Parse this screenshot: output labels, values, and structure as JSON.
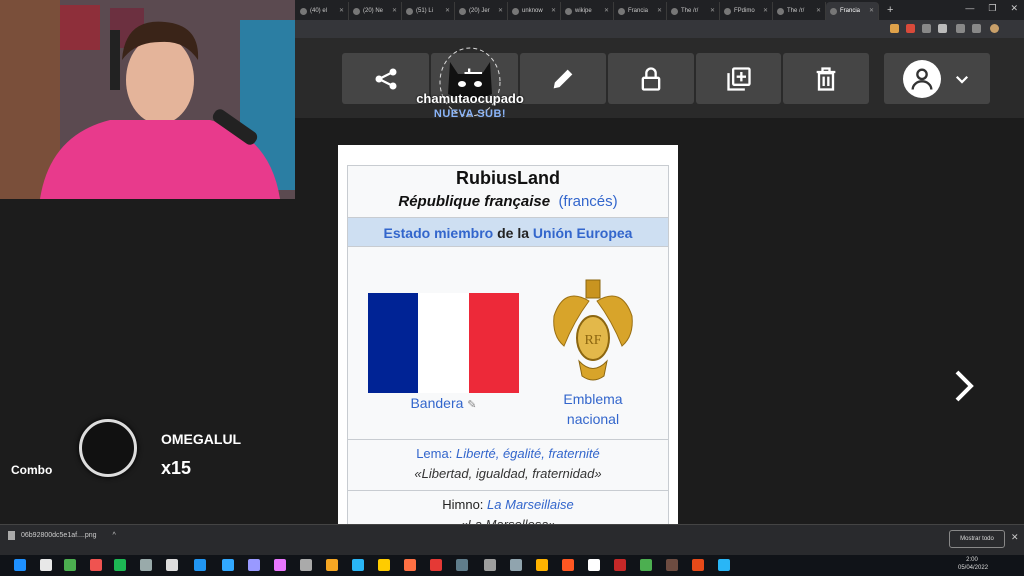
{
  "browser": {
    "tabs": [
      {
        "label": "(40) el"
      },
      {
        "label": "(20) Ne"
      },
      {
        "label": "(51) Li"
      },
      {
        "label": "(20) Jer"
      },
      {
        "label": "unknow"
      },
      {
        "label": "wikipe"
      },
      {
        "label": "Francia"
      },
      {
        "label": "The /r/"
      },
      {
        "label": "FPdimo"
      },
      {
        "label": "The /r/"
      },
      {
        "label": "Francia",
        "active": true
      }
    ],
    "new_tab": "+"
  },
  "viewer_toolbar": {
    "icons": [
      "share-icon",
      "crop-rotate-icon",
      "edit-pencil-icon",
      "lock-icon",
      "copy-add-icon",
      "trash-icon"
    ],
    "user_icon": "user-avatar-icon",
    "dropdown_icon": "chevron-down-icon"
  },
  "sub_alert": {
    "name": "chamutaocupado",
    "message": "NUEVA SUB!"
  },
  "infobox": {
    "title": "RubiusLand",
    "official_name": "République française",
    "language": "(francés)",
    "band_pre": "Estado miembro",
    "band_mid": "de la",
    "band_link": "Unión Europea",
    "flag_caption": "Bandera",
    "emblem_caption_1": "Emblema",
    "emblem_caption_2": "nacional",
    "motto_label": "Lema:",
    "motto": "Liberté, égalité, fraternité",
    "motto_translation": "«Libertad, igualdad, fraternidad»",
    "anthem_label": "Himno:",
    "anthem": "La Marseillaise",
    "anthem_translation": "«La Marsellesa»",
    "flag_colors": [
      "#002395",
      "#ffffff",
      "#ed2939"
    ]
  },
  "stream_overlay": {
    "combo_label": "Combo",
    "emote_name": "OMEGALUL",
    "combo_count": "x15"
  },
  "download_bar": {
    "file_name": "06b92800dc5e1af....png",
    "show_all": "Mostrar todo",
    "close": "✕"
  },
  "taskbar": {
    "time": "2:00",
    "date": "05/04/2022"
  }
}
